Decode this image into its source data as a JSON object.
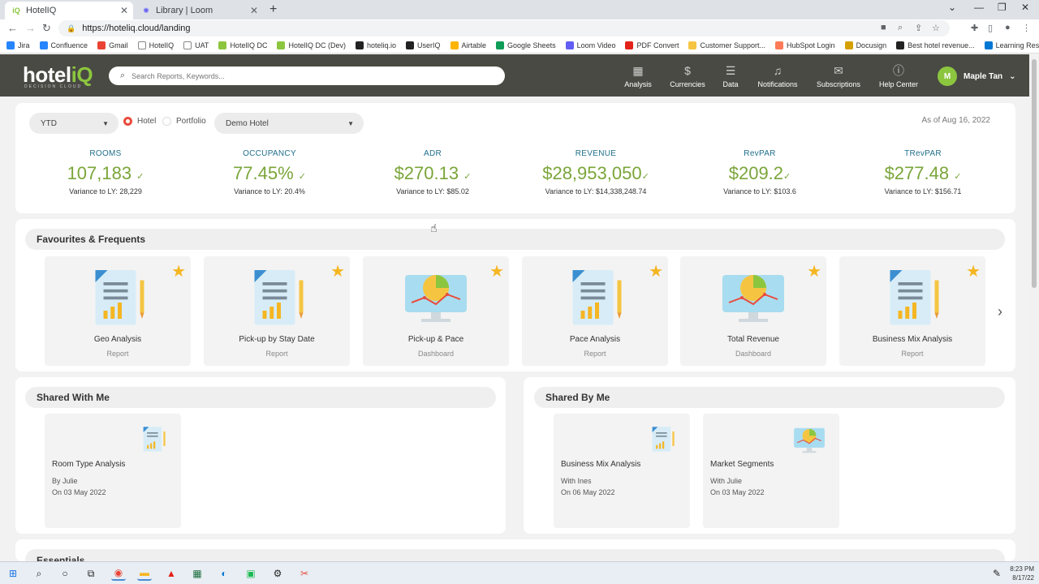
{
  "browser": {
    "tabs": [
      {
        "title": "HotelIQ",
        "favicon": "hoteliq-icon"
      },
      {
        "title": "Library | Loom",
        "favicon": "loom-icon"
      }
    ],
    "url": "https://hoteliq.cloud/landing",
    "bookmarks": [
      {
        "label": "Jira",
        "color": "#2684ff"
      },
      {
        "label": "Confluence",
        "color": "#2684ff"
      },
      {
        "label": "Gmail",
        "color": "#ea4335"
      },
      {
        "label": "HotelIQ",
        "color": "#ffffff"
      },
      {
        "label": "UAT",
        "color": "#ffffff"
      },
      {
        "label": "HotelIQ DC",
        "color": "#8cc63f"
      },
      {
        "label": "HotelIQ DC (Dev)",
        "color": "#8cc63f"
      },
      {
        "label": "hoteliq.io",
        "color": "#222222"
      },
      {
        "label": "UserIQ",
        "color": "#222222"
      },
      {
        "label": "Airtable",
        "color": "#fcb400"
      },
      {
        "label": "Google Sheets",
        "color": "#0f9d58"
      },
      {
        "label": "Loom Video",
        "color": "#625df5"
      },
      {
        "label": "PDF Convert",
        "color": "#e2231a"
      },
      {
        "label": "Customer Support...",
        "color": "#f5c542"
      },
      {
        "label": "HubSpot Login",
        "color": "#ff7a59"
      },
      {
        "label": "Docusign",
        "color": "#d5a100"
      },
      {
        "label": "Best hotel revenue...",
        "color": "#222222"
      },
      {
        "label": "Learning Resources...",
        "color": "#0078d4"
      }
    ]
  },
  "header": {
    "logo_main": "hotel",
    "logo_accent": "iQ",
    "logo_sub": "DECISION CLOUD",
    "search_placeholder": "Search Reports, Keywords...",
    "nav": [
      {
        "label": "Analysis",
        "icon": "grid-icon"
      },
      {
        "label": "Currencies",
        "icon": "dollar-icon"
      },
      {
        "label": "Data",
        "icon": "database-icon"
      },
      {
        "label": "Notifications",
        "icon": "bell-icon"
      },
      {
        "label": "Subscriptions",
        "icon": "mail-icon"
      },
      {
        "label": "Help Center",
        "icon": "info-icon"
      }
    ],
    "user": {
      "initial": "M",
      "name": "Maple Tan"
    }
  },
  "filters": {
    "period": "YTD",
    "radio_hotel": "Hotel",
    "radio_portfolio": "Portfolio",
    "hotel_select": "Demo Hotel",
    "as_of": "As of Aug 16, 2022"
  },
  "kpis": [
    {
      "label": "ROOMS",
      "value": "107,183",
      "variance": "Variance to LY: 28,229"
    },
    {
      "label": "OCCUPANCY",
      "value": "77.45%",
      "variance": "Variance to LY: 20.4%"
    },
    {
      "label": "ADR",
      "value": "$270.13",
      "variance": "Variance to LY: $85.02"
    },
    {
      "label": "REVENUE",
      "value": "$28,953,050",
      "variance": "Variance to LY: $14,338,248.74"
    },
    {
      "label": "RevPAR",
      "value": "$209.2",
      "variance": "Variance to LY: $103.6"
    },
    {
      "label": "TRevPAR",
      "value": "$277.48",
      "variance": "Variance to LY: $156.71"
    }
  ],
  "favourites": {
    "title": "Favourites & Frequents",
    "items": [
      {
        "name": "Geo Analysis",
        "type": "Report"
      },
      {
        "name": "Pick-up by Stay Date",
        "type": "Report"
      },
      {
        "name": "Pick-up & Pace",
        "type": "Dashboard"
      },
      {
        "name": "Pace Analysis",
        "type": "Report"
      },
      {
        "name": "Total Revenue",
        "type": "Dashboard"
      },
      {
        "name": "Business Mix Analysis",
        "type": "Report"
      }
    ]
  },
  "shared_with_me": {
    "title": "Shared With Me",
    "items": [
      {
        "name": "Room Type Analysis",
        "by": "By Julie",
        "on": "On 03 May 2022"
      }
    ]
  },
  "shared_by_me": {
    "title": "Shared By Me",
    "items": [
      {
        "name": "Business Mix Analysis",
        "by": "With Ines",
        "on": "On 06 May 2022"
      },
      {
        "name": "Market Segments",
        "by": "With Julie",
        "on": "On 03 May 2022"
      }
    ]
  },
  "essentials": {
    "title": "Essentials"
  },
  "taskbar": {
    "time": "8:23 PM",
    "date": "8/17/22"
  }
}
